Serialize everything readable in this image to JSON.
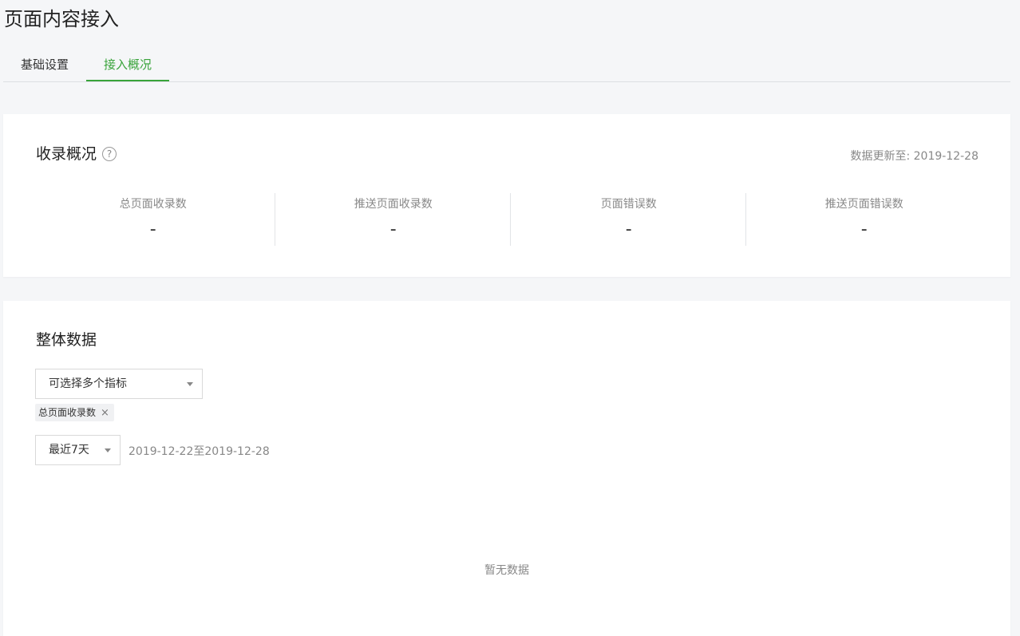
{
  "page": {
    "title": "页面内容接入"
  },
  "tabs": [
    {
      "label": "基础设置",
      "active": false
    },
    {
      "label": "接入概况",
      "active": true
    }
  ],
  "overview": {
    "title": "收录概况",
    "help_glyph": "?",
    "updated": "数据更新至: 2019-12-28",
    "stats": [
      {
        "label": "总页面收录数",
        "value": "-"
      },
      {
        "label": "推送页面收录数",
        "value": "-"
      },
      {
        "label": "页面错误数",
        "value": "-"
      },
      {
        "label": "推送页面错误数",
        "value": "-"
      }
    ]
  },
  "overall": {
    "title": "整体数据",
    "metric_select": {
      "value": "可选择多个指标"
    },
    "selected_tags": [
      {
        "label": "总页面收录数",
        "remove_glyph": "×"
      }
    ],
    "range_select": {
      "value": "最近7天"
    },
    "date_range": "2019-12-22至2019-12-28",
    "empty_text": "暂无数据"
  },
  "colors": {
    "accent": "#38a33a",
    "background": "#f5f6f8"
  },
  "icons": {
    "help": "help-circle-icon",
    "caret": "caret-down-icon",
    "remove": "close-icon"
  }
}
